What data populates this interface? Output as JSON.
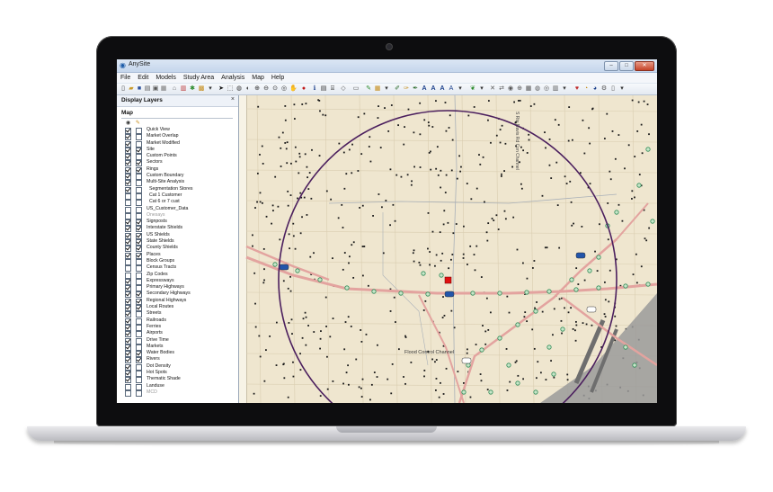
{
  "app": {
    "title": "AnySite",
    "icon": "globe-icon"
  },
  "window_controls": {
    "minimize": "–",
    "maximize": "□",
    "close": "✕"
  },
  "menu": [
    "File",
    "Edit",
    "Models",
    "Study Area",
    "Analysis",
    "Map",
    "Help"
  ],
  "side_panel": {
    "title": "Display Layers",
    "close": "×",
    "section": "Map",
    "layers": [
      {
        "label": "Quick View",
        "visible": true,
        "labeled": false
      },
      {
        "label": "Market Overlap",
        "visible": true,
        "labeled": false
      },
      {
        "label": "Market Modified",
        "visible": true,
        "labeled": false
      },
      {
        "label": "Site",
        "visible": true,
        "labeled": true
      },
      {
        "label": "Custom Points",
        "visible": true,
        "labeled": false
      },
      {
        "label": "Sectors",
        "visible": true,
        "labeled": true
      },
      {
        "label": "Rings",
        "visible": true,
        "labeled": true
      },
      {
        "label": "Custom Boundary",
        "visible": true,
        "labeled": false
      },
      {
        "label": "Multi-Site Analysis",
        "visible": true,
        "labeled": false
      },
      {
        "label": "Segmentation Stores",
        "visible": true,
        "labeled": false,
        "indent": true
      },
      {
        "label": "Cat 1 Customer",
        "visible": false,
        "labeled": false,
        "indent": true
      },
      {
        "label": "Cat 6 or 7 cust",
        "visible": false,
        "labeled": false,
        "indent": true
      },
      {
        "label": "US_Customer_Data",
        "visible": false,
        "labeled": false
      },
      {
        "label": "Onesays",
        "visible": false,
        "labeled": false,
        "dim": true
      },
      {
        "label": "Signposts",
        "visible": true,
        "labeled": true
      },
      {
        "label": "Interstate Shields",
        "visible": true,
        "labeled": true
      },
      {
        "label": "US Shields",
        "visible": true,
        "labeled": true
      },
      {
        "label": "State Shields",
        "visible": true,
        "labeled": true
      },
      {
        "label": "County Shields",
        "visible": true,
        "labeled": true
      },
      {
        "label": "Places",
        "visible": true,
        "labeled": true
      },
      {
        "label": "Block Groups",
        "visible": false,
        "labeled": false
      },
      {
        "label": "Census Tracts",
        "visible": false,
        "labeled": false
      },
      {
        "label": "Zip Codes",
        "visible": false,
        "labeled": false
      },
      {
        "label": "Expressways",
        "visible": true,
        "labeled": false
      },
      {
        "label": "Primary Highways",
        "visible": true,
        "labeled": false
      },
      {
        "label": "Secondary Highways",
        "visible": true,
        "labeled": true
      },
      {
        "label": "Regional Highways",
        "visible": true,
        "labeled": true
      },
      {
        "label": "Local Routes",
        "visible": true,
        "labeled": true
      },
      {
        "label": "Streets",
        "visible": true,
        "labeled": false
      },
      {
        "label": "Railroads",
        "visible": true,
        "labeled": false
      },
      {
        "label": "Ferries",
        "visible": true,
        "labeled": false
      },
      {
        "label": "Airports",
        "visible": true,
        "labeled": false
      },
      {
        "label": "Drive Time",
        "visible": true,
        "labeled": false
      },
      {
        "label": "Markets",
        "visible": true,
        "labeled": false
      },
      {
        "label": "Water Bodies",
        "visible": true,
        "labeled": true
      },
      {
        "label": "Rivers",
        "visible": true,
        "labeled": true
      },
      {
        "label": "Dot Density",
        "visible": true,
        "labeled": false
      },
      {
        "label": "Hot Spots",
        "visible": true,
        "labeled": false
      },
      {
        "label": "Thematic Shade",
        "visible": true,
        "labeled": false
      },
      {
        "label": "Landuse",
        "visible": false,
        "labeled": false
      },
      {
        "label": "MCD",
        "visible": false,
        "labeled": false,
        "dim": true
      }
    ]
  },
  "map": {
    "labels": {
      "channel": "Flood Control Channel",
      "vertical_street": "S Rte Davis Rd Con Channel",
      "shield_1": "465",
      "shield_2": "465",
      "shield_3": "465",
      "shield_4": "14",
      "shield_5": "71"
    },
    "colors": {
      "background": "#efe6cf",
      "ring": "#4b1f5e",
      "highway": "#e3a39f",
      "site": "#e01010",
      "airport": "#9a9a9a",
      "points": "#2e8b57"
    }
  }
}
